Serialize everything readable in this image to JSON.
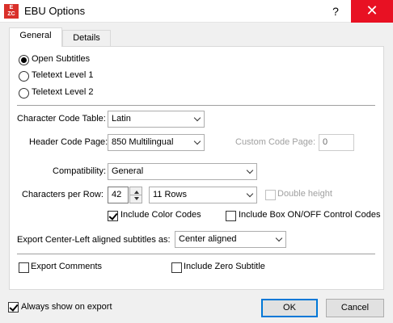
{
  "window": {
    "title": "EBU Options",
    "help_glyph": "?",
    "close_glyph": "✕",
    "icon_letters": [
      "E",
      "Z",
      "C"
    ]
  },
  "tabs": [
    {
      "label": "General",
      "selected": true
    },
    {
      "label": "Details",
      "selected": false
    }
  ],
  "general": {
    "subtitle_type": {
      "options": [
        {
          "label": "Open Subtitles",
          "checked": true
        },
        {
          "label": "Teletext Level 1",
          "checked": false
        },
        {
          "label": "Teletext Level 2",
          "checked": false
        }
      ]
    },
    "character_code_table": {
      "label": "Character Code Table:",
      "value": "Latin"
    },
    "header_code_page": {
      "label": "Header Code Page:",
      "value": "850 Multilingual"
    },
    "custom_code_page": {
      "label": "Custom Code Page:",
      "value": "0",
      "enabled": false
    },
    "compatibility": {
      "label": "Compatibility:",
      "value": "General"
    },
    "characters_per_row": {
      "label": "Characters per Row:",
      "value": "42"
    },
    "rows": {
      "value": "11 Rows"
    },
    "double_height": {
      "label": "Double height",
      "checked": false,
      "enabled": false
    },
    "include_color_codes": {
      "label": "Include Color Codes",
      "checked": true
    },
    "include_box_codes": {
      "label": "Include Box ON/OFF Control Codes",
      "checked": false
    },
    "export_center_left": {
      "label": "Export Center-Left aligned subtitles as:",
      "value": "Center aligned"
    },
    "export_comments": {
      "label": "Export Comments",
      "checked": false
    },
    "include_zero_subtitle": {
      "label": "Include Zero Subtitle",
      "checked": false
    }
  },
  "footer": {
    "always_show": {
      "label": "Always show on export",
      "checked": true
    },
    "ok_label": "OK",
    "cancel_label": "Cancel"
  }
}
